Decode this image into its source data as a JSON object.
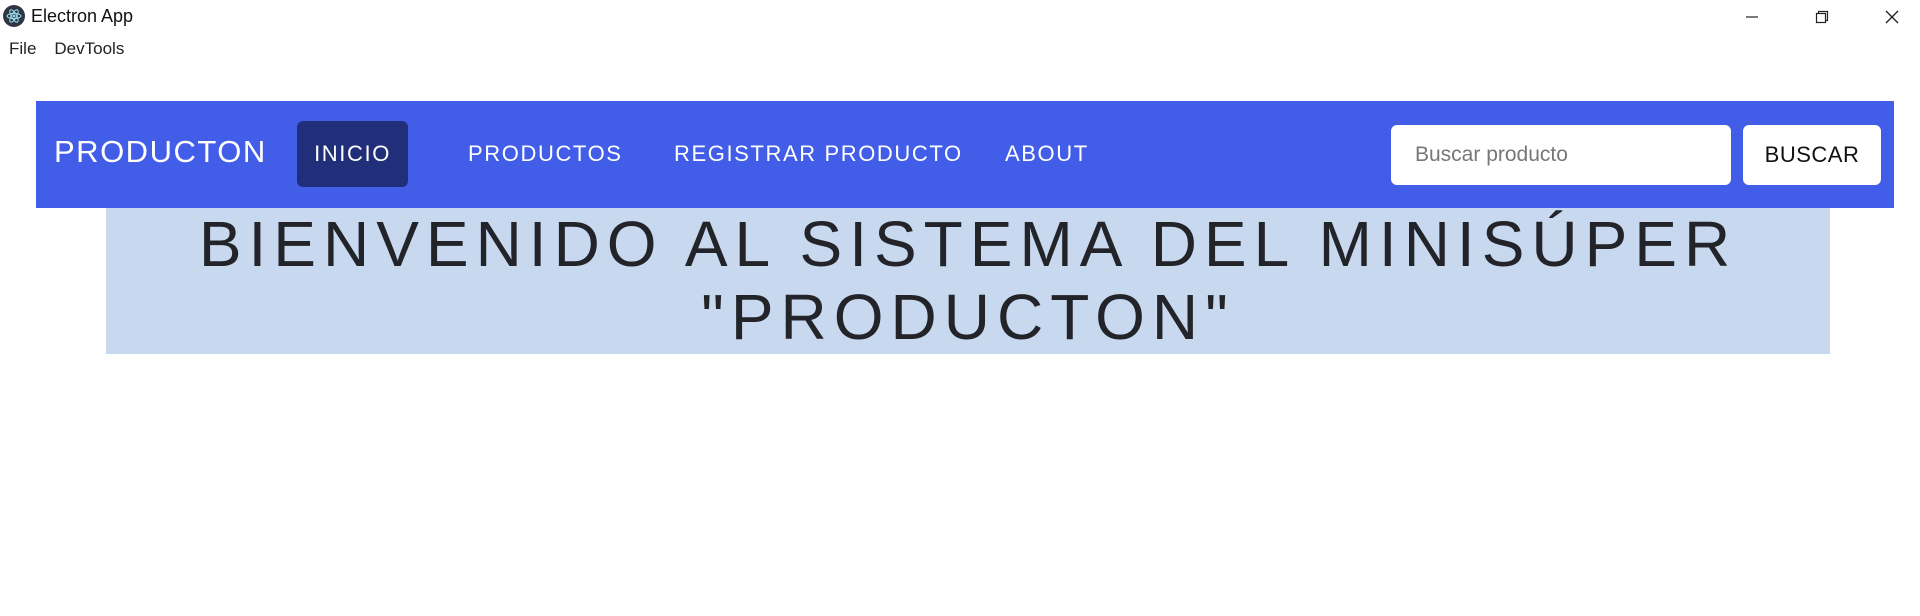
{
  "window": {
    "title": "Electron App",
    "icon": "electron-icon",
    "controls": [
      "minimize-icon",
      "maximize-icon",
      "close-icon"
    ]
  },
  "menubar": {
    "items": [
      "File",
      "DevTools"
    ]
  },
  "navbar": {
    "brand": "PRODUCTON",
    "links": [
      {
        "label": "INICIO",
        "active": true
      },
      {
        "label": "PRODUCTOS",
        "active": false
      },
      {
        "label": "REGISTRAR PRODUCTO",
        "active": false
      },
      {
        "label": "ABOUT",
        "active": false
      }
    ],
    "search": {
      "placeholder": "Buscar producto",
      "value": "",
      "button_label": "BUSCAR"
    }
  },
  "banner": {
    "line1": "BIENVENIDO AL SISTEMA DEL MINISÚPER",
    "line2": "\"PRODUCTON\""
  },
  "colors": {
    "navbar": "#425de8",
    "active_link": "#212f7a",
    "banner": "#c8d8ef"
  }
}
